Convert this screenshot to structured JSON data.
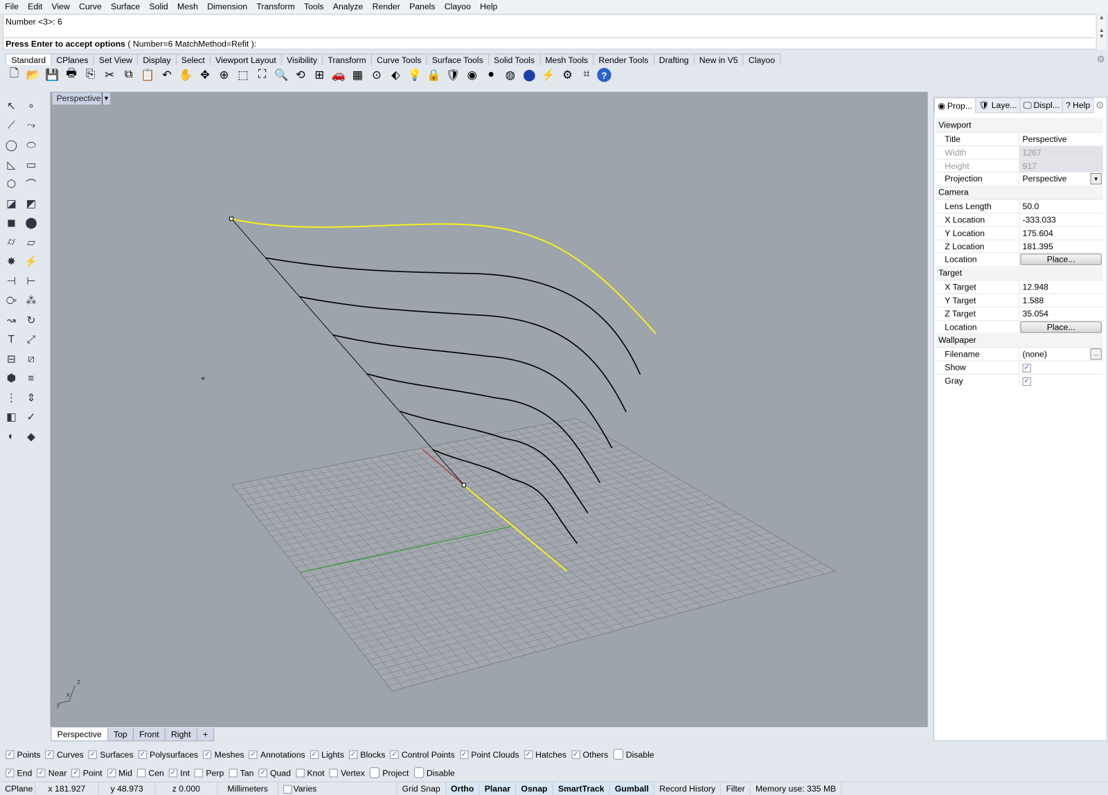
{
  "menu": [
    "File",
    "Edit",
    "View",
    "Curve",
    "Surface",
    "Solid",
    "Mesh",
    "Dimension",
    "Transform",
    "Tools",
    "Analyze",
    "Render",
    "Panels",
    "Clayoo",
    "Help"
  ],
  "command": {
    "history": "Number <3>: 6",
    "prompt_bold": "Press Enter to accept options",
    "prompt_rest": " ( Number=6  MatchMethod=Refit ):"
  },
  "toolbar_tabs": [
    "Standard",
    "CPlanes",
    "Set View",
    "Display",
    "Select",
    "Viewport Layout",
    "Visibility",
    "Transform",
    "Curve Tools",
    "Surface Tools",
    "Solid Tools",
    "Mesh Tools",
    "Render Tools",
    "Drafting",
    "New in V5",
    "Clayoo"
  ],
  "toolbar_icons": [
    {
      "name": "new-icon",
      "glyph": "🗋"
    },
    {
      "name": "open-icon",
      "glyph": "📂"
    },
    {
      "name": "save-icon",
      "glyph": "💾"
    },
    {
      "name": "print-icon",
      "glyph": "🖶"
    },
    {
      "name": "export-icon",
      "glyph": "⎘"
    },
    {
      "name": "cut-icon",
      "glyph": "✂"
    },
    {
      "name": "copy-icon",
      "glyph": "⧉"
    },
    {
      "name": "paste-icon",
      "glyph": "📋"
    },
    {
      "name": "undo-icon",
      "glyph": "↶"
    },
    {
      "name": "pan-hand-icon",
      "glyph": "✋"
    },
    {
      "name": "rotate-view-icon",
      "glyph": "✥"
    },
    {
      "name": "zoom-icon",
      "glyph": "⊕"
    },
    {
      "name": "zoom-window-icon",
      "glyph": "⬚"
    },
    {
      "name": "zoom-extents-icon",
      "glyph": "⛶"
    },
    {
      "name": "zoom-selected-icon",
      "glyph": "🔍"
    },
    {
      "name": "undo-view-icon",
      "glyph": "⟲"
    },
    {
      "name": "four-viewports-icon",
      "glyph": "⊞"
    },
    {
      "name": "car-icon",
      "glyph": "🚗"
    },
    {
      "name": "grid-icon",
      "glyph": "▦"
    },
    {
      "name": "osnap-icon",
      "glyph": "⊙"
    },
    {
      "name": "select-points-icon",
      "glyph": "⬖"
    },
    {
      "name": "light-bulb-icon",
      "glyph": "💡"
    },
    {
      "name": "lock-icon",
      "glyph": "🔒"
    },
    {
      "name": "layer-icon",
      "glyph": "🛡"
    },
    {
      "name": "color-wheel-icon",
      "glyph": "◉"
    },
    {
      "name": "shaded-sphere-icon",
      "glyph": "●"
    },
    {
      "name": "rendered-sphere-icon",
      "glyph": "◍"
    },
    {
      "name": "blue-sphere-icon",
      "glyph": "⬤"
    },
    {
      "name": "filter-icon",
      "glyph": "⚡"
    },
    {
      "name": "settings-gear-icon",
      "glyph": "⚙"
    },
    {
      "name": "snap-icon",
      "glyph": "⌗"
    },
    {
      "name": "help-icon",
      "glyph": "?"
    }
  ],
  "left_icons": [
    [
      "select-arrow-icon",
      "↖"
    ],
    [
      "point-icon",
      "∘"
    ],
    [
      "polyline-icon",
      "⟋"
    ],
    [
      "curve-control-points-icon",
      "⤳"
    ],
    [
      "circle-icon",
      "◯"
    ],
    [
      "ellipse-icon",
      "⬭"
    ],
    [
      "arc-icon",
      "◺"
    ],
    [
      "rectangle-icon",
      "▭"
    ],
    [
      "polygon-icon",
      "⬡"
    ],
    [
      "fillet-curve-icon",
      "⌒"
    ],
    [
      "surface-corner-icon",
      "◪"
    ],
    [
      "surface-edge-icon",
      "◩"
    ],
    [
      "box-icon",
      "◼"
    ],
    [
      "sphere-icon",
      "⬤"
    ],
    [
      "cylinder-icon",
      "⌭"
    ],
    [
      "plane-icon",
      "▱"
    ],
    [
      "explode-icon",
      "✸"
    ],
    [
      "split-icon",
      "⚡"
    ],
    [
      "trim-icon",
      "⊣"
    ],
    [
      "extend-icon",
      "⊢"
    ],
    [
      "boolean-union-icon",
      "⧂"
    ],
    [
      "boolean-split-icon",
      "⁂"
    ],
    [
      "move-icon",
      "↝"
    ],
    [
      "rotate-icon",
      "↻"
    ],
    [
      "text-icon",
      "T"
    ],
    [
      "dimension-icon",
      "⤢"
    ],
    [
      "group-icon",
      "⊟"
    ],
    [
      "block-icon",
      "⧄"
    ],
    [
      "mesh-icon",
      "⬢"
    ],
    [
      "hatch-icon",
      "≡"
    ],
    [
      "array-icon",
      "⋮"
    ],
    [
      "scale-icon",
      "⇕"
    ],
    [
      "analyze-icon",
      "◧"
    ],
    [
      "check-icon",
      "✓"
    ],
    [
      "render-icon",
      "◐"
    ],
    [
      "materials-icon",
      "◆"
    ]
  ],
  "viewport": {
    "title": "Perspective",
    "axis_labels": {
      "z": "z",
      "x": "x",
      "y": "y"
    },
    "colors": {
      "background": "#9ea4ab",
      "selected_curve": "#f5f01e",
      "curve": "#000000",
      "x_axis": "#b33a3a",
      "y_axis": "#3c9a3c",
      "grid": "#7e848b"
    }
  },
  "viewport_tabs": [
    "Perspective",
    "Top",
    "Front",
    "Right",
    "+"
  ],
  "panel": {
    "tabs": [
      {
        "icon": "color-wheel-icon",
        "label": "Prop..."
      },
      {
        "icon": "layers-icon",
        "label": "Laye..."
      },
      {
        "icon": "display-icon",
        "label": "Displ..."
      },
      {
        "icon": "help-icon",
        "label": "Help"
      }
    ],
    "sections": [
      {
        "title": "Viewport",
        "rows": [
          {
            "k": "Title",
            "v": "Perspective"
          },
          {
            "k": "Width",
            "v": "1267",
            "disabled": true
          },
          {
            "k": "Height",
            "v": "917",
            "disabled": true
          },
          {
            "k": "Projection",
            "v": "Perspective",
            "type": "dropdown"
          }
        ]
      },
      {
        "title": "Camera",
        "rows": [
          {
            "k": "Lens Length",
            "v": "50.0"
          },
          {
            "k": "X Location",
            "v": "-333.033"
          },
          {
            "k": "Y Location",
            "v": "175.604"
          },
          {
            "k": "Z Location",
            "v": "181.395"
          },
          {
            "k": "Location",
            "v": "Place...",
            "type": "button"
          }
        ]
      },
      {
        "title": "Target",
        "rows": [
          {
            "k": "X Target",
            "v": "12.948"
          },
          {
            "k": "Y Target",
            "v": "1.588"
          },
          {
            "k": "Z Target",
            "v": "35.054"
          },
          {
            "k": "Location",
            "v": "Place...",
            "type": "button"
          }
        ]
      },
      {
        "title": "Wallpaper",
        "rows": [
          {
            "k": "Filename",
            "v": "(none)",
            "type": "file"
          },
          {
            "k": "Show",
            "v": true,
            "type": "check"
          },
          {
            "k": "Gray",
            "v": true,
            "type": "check"
          }
        ]
      }
    ]
  },
  "filters": [
    {
      "l": "Points",
      "c": true
    },
    {
      "l": "Curves",
      "c": true
    },
    {
      "l": "Surfaces",
      "c": true
    },
    {
      "l": "Polysurfaces",
      "c": true
    },
    {
      "l": "Meshes",
      "c": true
    },
    {
      "l": "Annotations",
      "c": true
    },
    {
      "l": "Lights",
      "c": true
    },
    {
      "l": "Blocks",
      "c": true
    },
    {
      "l": "Control Points",
      "c": true
    },
    {
      "l": "Point Clouds",
      "c": true
    },
    {
      "l": "Hatches",
      "c": true
    },
    {
      "l": "Others",
      "c": true
    },
    {
      "l": "Disable",
      "c": false,
      "round": true
    }
  ],
  "osnaps": [
    {
      "l": "End",
      "c": true
    },
    {
      "l": "Near",
      "c": true
    },
    {
      "l": "Point",
      "c": true
    },
    {
      "l": "Mid",
      "c": true
    },
    {
      "l": "Cen",
      "c": false
    },
    {
      "l": "Int",
      "c": true
    },
    {
      "l": "Perp",
      "c": false
    },
    {
      "l": "Tan",
      "c": false
    },
    {
      "l": "Quad",
      "c": true
    },
    {
      "l": "Knot",
      "c": false
    },
    {
      "l": "Vertex",
      "c": false
    },
    {
      "l": "Project",
      "c": false,
      "round": true
    },
    {
      "l": "Disable",
      "c": false,
      "round": true
    }
  ],
  "status": {
    "cplane": "CPlane",
    "x": "x 181.927",
    "y": "y 48.973",
    "z": "z 0.000",
    "units": "Millimeters",
    "layer": "Varies",
    "toggles": [
      {
        "l": "Grid Snap",
        "on": false
      },
      {
        "l": "Ortho",
        "on": true
      },
      {
        "l": "Planar",
        "on": true
      },
      {
        "l": "Osnap",
        "on": true
      },
      {
        "l": "SmartTrack",
        "on": true
      },
      {
        "l": "Gumball",
        "on": true
      },
      {
        "l": "Record History",
        "on": false
      },
      {
        "l": "Filter",
        "on": false
      }
    ],
    "memory": "Memory use: 335 MB"
  }
}
